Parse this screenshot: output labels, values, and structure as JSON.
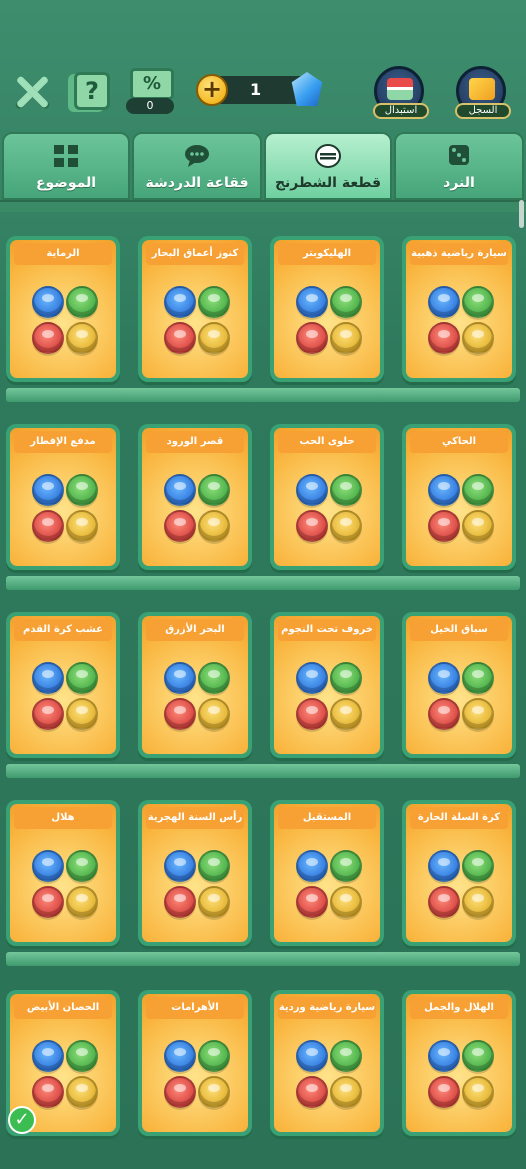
{
  "top": {
    "ticket_symbol": "%",
    "ticket_count": "0",
    "help_symbol": "?",
    "plus_symbol": "+",
    "currency_value": "1",
    "exchange_label": "استبدال",
    "log_label": "السجل"
  },
  "tabs": [
    {
      "label": "النرد",
      "icon": "dice-icon"
    },
    {
      "label": "قطعة الشطرنج",
      "icon": "piece-icon",
      "active": true
    },
    {
      "label": "فقاعة الدردشة",
      "icon": "chat-bubble-icon"
    },
    {
      "label": "الموضوع",
      "icon": "theme-grid-icon"
    }
  ],
  "cards": [
    [
      "سيارة رياضية ذهبية",
      "الهليكوبتر",
      "كنوز أعماق البحار",
      "الرماية"
    ],
    [
      "الحاكي",
      "حلوى الحب",
      "قصر الورود",
      "مدفع الإفطار"
    ],
    [
      "سباق الخيل",
      "خروف تحت النجوم",
      "البحر الأزرق",
      "عشب كرة القدم"
    ],
    [
      "كرة السلة الحارة",
      "المستقبل",
      "رأس السنة الهجرية",
      "هلال"
    ],
    [
      "الهلال والجمل",
      "سيارة رياضية وردية",
      "الأهرامات",
      "الحصان الأبيض"
    ]
  ],
  "selected_check": "✓",
  "colors": {
    "accent": "#3aa174",
    "card": "#f9b640",
    "piece_blue": "#1a5fcf",
    "piece_green": "#2f9a34",
    "piece_red": "#c82a2a",
    "piece_yellow": "#d7a010"
  }
}
